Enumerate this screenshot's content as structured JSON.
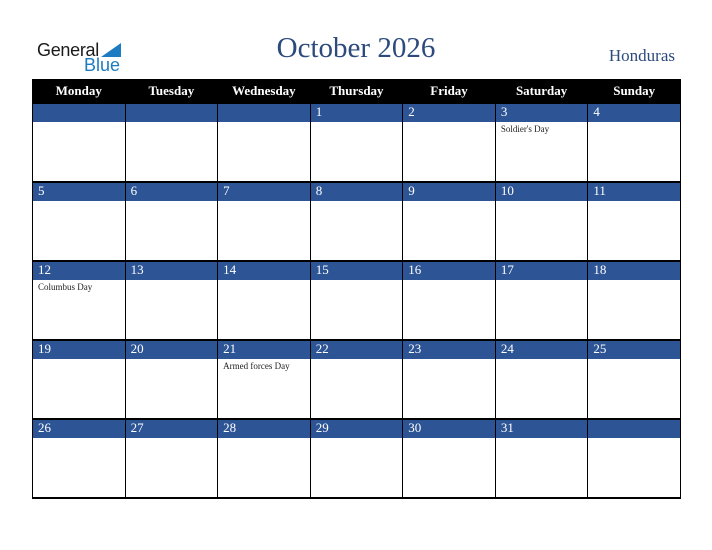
{
  "logo": {
    "general": "General",
    "blue": "Blue"
  },
  "title": "October 2026",
  "country": "Honduras",
  "colors": {
    "header_bg": "#000000",
    "date_bar": "#2d5494",
    "title": "#2c4a7c",
    "logo_blue": "#1d7bc2"
  },
  "weekdays": [
    "Monday",
    "Tuesday",
    "Wednesday",
    "Thursday",
    "Friday",
    "Saturday",
    "Sunday"
  ],
  "weeks": [
    {
      "days": [
        "",
        "",
        "",
        "1",
        "2",
        "3",
        "4"
      ],
      "events": [
        "",
        "",
        "",
        "",
        "",
        "Soldier's Day",
        ""
      ]
    },
    {
      "days": [
        "5",
        "6",
        "7",
        "8",
        "9",
        "10",
        "11"
      ],
      "events": [
        "",
        "",
        "",
        "",
        "",
        "",
        ""
      ]
    },
    {
      "days": [
        "12",
        "13",
        "14",
        "15",
        "16",
        "17",
        "18"
      ],
      "events": [
        "Columbus Day",
        "",
        "",
        "",
        "",
        "",
        ""
      ]
    },
    {
      "days": [
        "19",
        "20",
        "21",
        "22",
        "23",
        "24",
        "25"
      ],
      "events": [
        "",
        "",
        "Armed forces Day",
        "",
        "",
        "",
        ""
      ]
    },
    {
      "days": [
        "26",
        "27",
        "28",
        "29",
        "30",
        "31",
        ""
      ],
      "events": [
        "",
        "",
        "",
        "",
        "",
        "",
        ""
      ]
    }
  ]
}
